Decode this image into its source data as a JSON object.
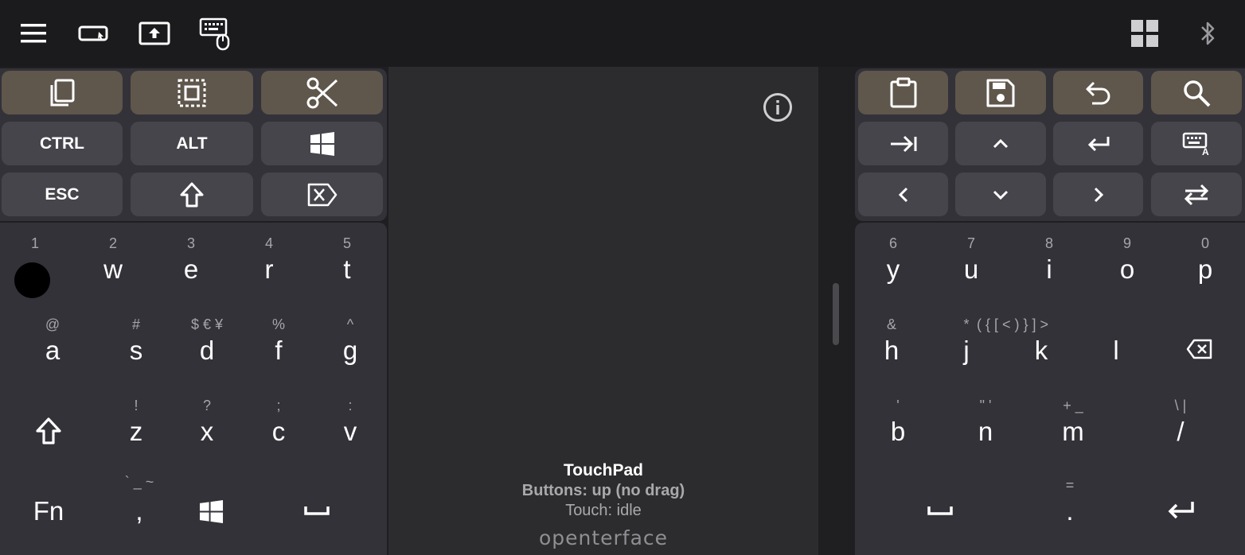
{
  "toolbar": {
    "left_icons": [
      "menu-icon",
      "mouse-keyboard-mode-icon",
      "screen-upload-icon",
      "keyboard-mouse-icon"
    ],
    "right_icons": [
      "grid-icon",
      "bluetooth-icon"
    ]
  },
  "left_panel": {
    "row1_icons": [
      "copy-icon",
      "select-all-icon",
      "cut-icon"
    ],
    "ctrl_label": "CTRL",
    "alt_label": "ALT",
    "esc_label": "ESC",
    "row2_icons": [
      "windows-icon"
    ],
    "row3_icons": [
      "shift-icon",
      "delete-icon"
    ]
  },
  "right_panel": {
    "row1_icons": [
      "clipboard-icon",
      "save-icon",
      "undo-icon",
      "search-icon"
    ],
    "row2_icons": [
      "tab-icon",
      "arrow-up-icon",
      "enter-icon",
      "keyboard-lang-icon"
    ],
    "row3_icons": [
      "arrow-left-icon",
      "arrow-down-icon",
      "arrow-right-icon",
      "swap-icon"
    ]
  },
  "touchpad": {
    "title": "TouchPad",
    "buttons_status": "Buttons: up (no drag)",
    "touch_status": "Touch: idle",
    "brand": "openterface"
  },
  "left_keys": {
    "row1": [
      {
        "hint": "1",
        "main": ""
      },
      {
        "hint": "2",
        "main": "w"
      },
      {
        "hint": "3",
        "main": "e"
      },
      {
        "hint": "4",
        "main": "r"
      },
      {
        "hint": "5",
        "main": "t"
      }
    ],
    "row2": [
      {
        "hint": "@",
        "main": "a"
      },
      {
        "hint": "#",
        "main": "s"
      },
      {
        "hint": "$ € ¥",
        "main": "d"
      },
      {
        "hint": "%",
        "main": "f"
      },
      {
        "hint": "^",
        "main": "g"
      }
    ],
    "row3": [
      {
        "hint": "!",
        "main": "z"
      },
      {
        "hint": "?",
        "main": "x"
      },
      {
        "hint": ";",
        "main": "c"
      },
      {
        "hint": ":",
        "main": "v"
      }
    ],
    "row4": {
      "fn": "Fn",
      "comma_hint": "` _ ~",
      "comma": ","
    }
  },
  "right_keys": {
    "row1": [
      {
        "hint": "6",
        "main": "y"
      },
      {
        "hint": "7",
        "main": "u"
      },
      {
        "hint": "8",
        "main": "i"
      },
      {
        "hint": "9",
        "main": "o"
      },
      {
        "hint": "0",
        "main": "p"
      }
    ],
    "row2": [
      {
        "hint": "&",
        "main": "h"
      },
      {
        "hint": "*",
        "main": "j"
      },
      {
        "hint": "( { [ < ) } ] >",
        "main": "k"
      },
      {
        "hint": "",
        "main": "l"
      }
    ],
    "row3": [
      {
        "hint": "'",
        "main": "b"
      },
      {
        "hint": "\" '",
        "main": "n"
      },
      {
        "hint": "+ _",
        "main": "m"
      },
      {
        "hint": "\\ |",
        "main": "/"
      }
    ],
    "row4": {
      "dot_hint": "=",
      "dot": "."
    }
  },
  "colors": {
    "background": "#1f1f21",
    "panel": "#333239",
    "button": "#45454b",
    "accent_button": "#5f564c",
    "touchpad": "#2c2c2e"
  }
}
